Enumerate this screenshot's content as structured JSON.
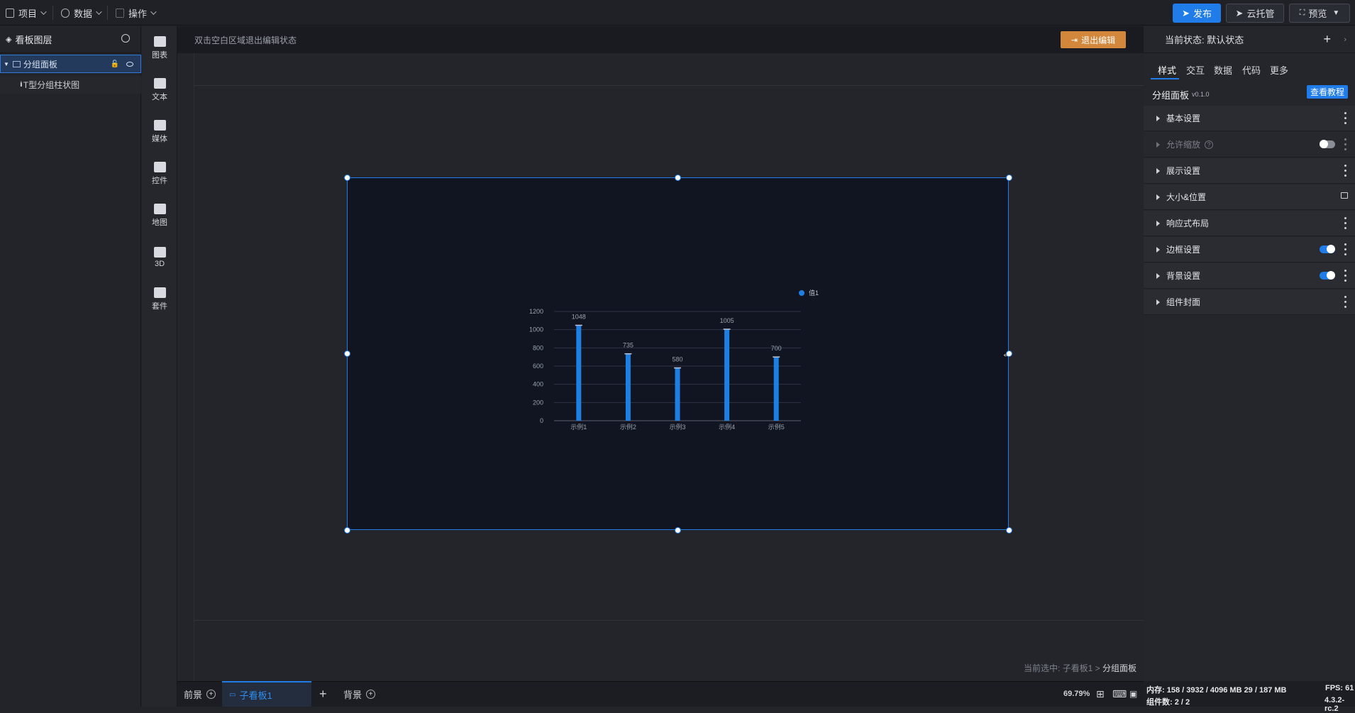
{
  "topbar": {
    "menus": [
      {
        "label": "项目"
      },
      {
        "label": "数据"
      },
      {
        "label": "操作"
      }
    ],
    "publish": "发布",
    "cloud": "云托管",
    "preview": "预览"
  },
  "layers": {
    "title": "看板图层",
    "items": [
      {
        "label": "分组面板"
      },
      {
        "label": "T型分组柱状图"
      }
    ]
  },
  "toolbox": [
    {
      "label": "图表",
      "icon": "chart-icon"
    },
    {
      "label": "文本",
      "icon": "text-icon"
    },
    {
      "label": "媒体",
      "icon": "media-icon"
    },
    {
      "label": "控件",
      "icon": "control-icon"
    },
    {
      "label": "地图",
      "icon": "map-icon"
    },
    {
      "label": "3D",
      "icon": "cube-icon"
    },
    {
      "label": "套件",
      "icon": "kit-icon"
    }
  ],
  "canvas": {
    "hint": "双击空白区域退出编辑状态",
    "exit_label": "退出编辑",
    "breadcrumb_prefix": "当前选中: 子看板1 >",
    "breadcrumb_current": "分组面板"
  },
  "chart_data": {
    "type": "bar",
    "categories": [
      "示例1",
      "示例2",
      "示例3",
      "示例4",
      "示例5"
    ],
    "series": [
      {
        "name": "值1",
        "values": [
          1048,
          735,
          580,
          1005,
          700
        ]
      }
    ],
    "ylim": [
      0,
      1200
    ],
    "yticks": [
      0,
      200,
      400,
      600,
      800,
      1000,
      1200
    ],
    "color": "#1e7fe2",
    "legend_position": "top-right",
    "grid": true
  },
  "bottom": {
    "tabs": [
      {
        "label": "前景"
      },
      {
        "label": "子看板1"
      },
      {
        "label": "背景"
      }
    ],
    "zoom": "69.79%"
  },
  "stats": {
    "memory": "内存: 158 / 3932 / 4096 MB  29 / 187 MB",
    "fps": "FPS: 61",
    "components": "组件数: 2 / 2",
    "version": "4.3.2-rc.2"
  },
  "right": {
    "state": "当前状态: 默认状态",
    "tabs": [
      {
        "label": "样式"
      },
      {
        "label": "交互"
      },
      {
        "label": "数据"
      },
      {
        "label": "代码"
      },
      {
        "label": "更多"
      }
    ],
    "component_name": "分组面板",
    "component_version": "v0.1.0",
    "tutorial": "查看教程",
    "sections": [
      {
        "label": "基本设置"
      },
      {
        "label": "允许缩放"
      },
      {
        "label": "展示设置"
      },
      {
        "label": "大小&位置"
      },
      {
        "label": "响应式布局"
      },
      {
        "label": "边框设置"
      },
      {
        "label": "背景设置"
      },
      {
        "label": "组件封面"
      }
    ]
  },
  "colors": {
    "accent": "#1f7ce8",
    "exit": "#d2873b"
  }
}
